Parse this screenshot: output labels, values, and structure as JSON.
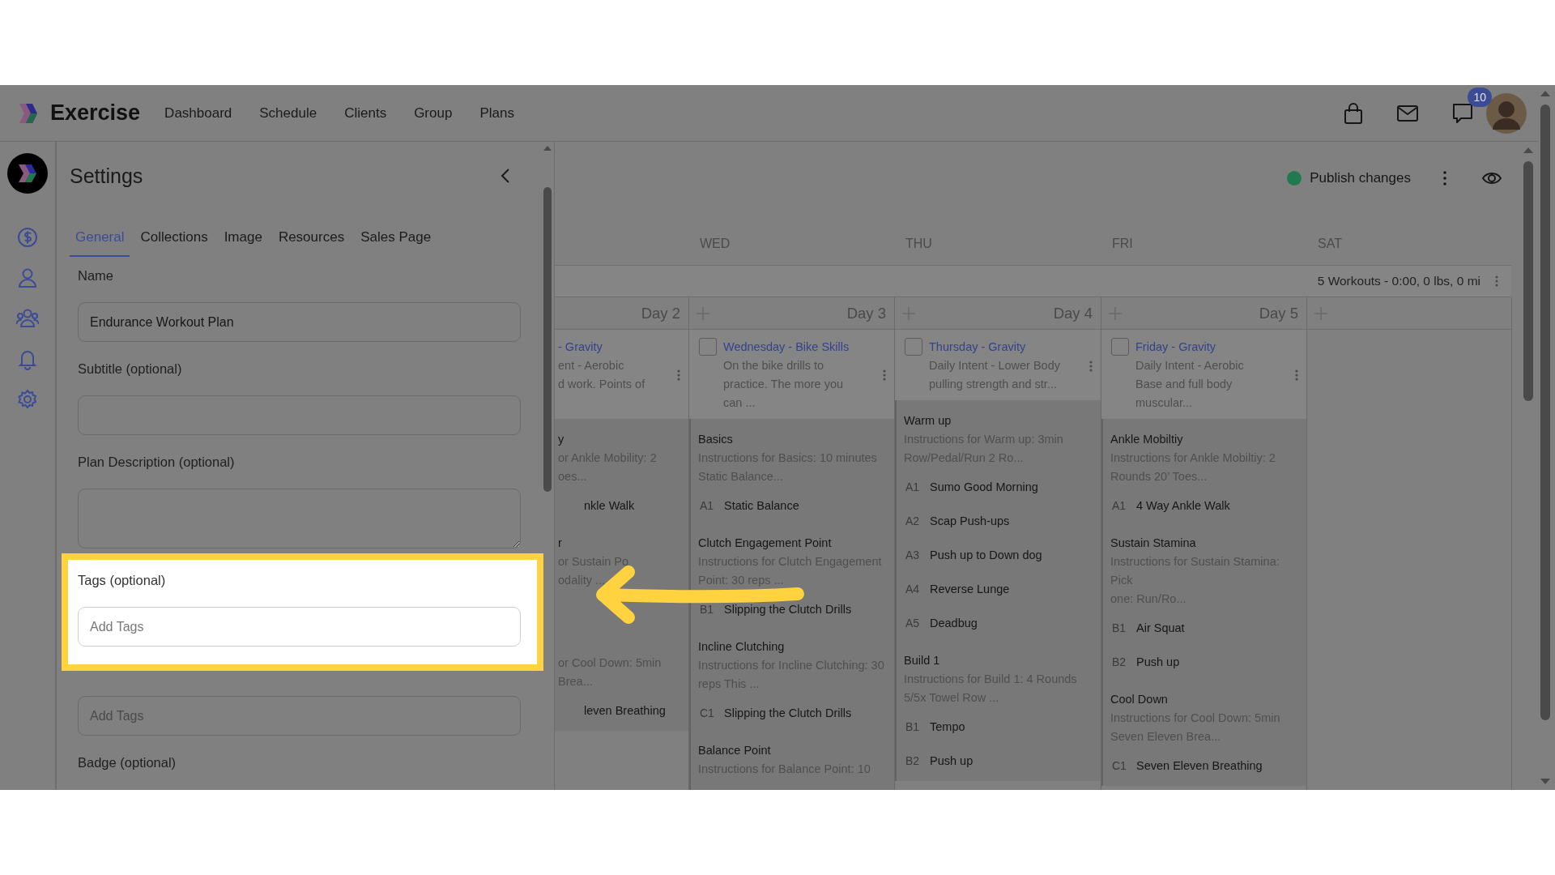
{
  "nav": {
    "brand": "Exercise",
    "links": [
      {
        "label": "Dashboard"
      },
      {
        "label": "Schedule"
      },
      {
        "label": "Clients"
      },
      {
        "label": "Group"
      },
      {
        "label": "Plans"
      }
    ],
    "chat_badge": "10"
  },
  "settings": {
    "title": "Settings",
    "tabs": [
      {
        "label": "General",
        "selected": true
      },
      {
        "label": "Collections",
        "selected": false
      },
      {
        "label": "Image",
        "selected": false
      },
      {
        "label": "Resources",
        "selected": false
      },
      {
        "label": "Sales Page",
        "selected": false
      }
    ],
    "fields": [
      {
        "kind": "input",
        "label": "Name",
        "value": "Endurance Workout Plan",
        "highlighted": false
      },
      {
        "kind": "input",
        "label": "Subtitle (optional)",
        "highlighted": false
      },
      {
        "kind": "textarea",
        "label": "Plan Description (optional)",
        "highlighted": false
      },
      {
        "kind": "input",
        "label": "Tags (optional)",
        "placeholder": "Add Tags",
        "highlighted": true
      },
      {
        "kind": "input",
        "placeholder": "Add Tags",
        "highlighted": false
      },
      {
        "kind": "label",
        "label": "Badge (optional)",
        "highlighted": false
      }
    ]
  },
  "toolbar": {
    "publish": "Publish changes"
  },
  "calendar": {
    "summary": "5 Workouts - 0:00, 0 lbs, 0 mi",
    "columns": [
      {
        "day_label": "Day 2",
        "add_button": false,
        "workout": {
          "title": "- Gravity",
          "description": "ent - Aerobic\nd work. Points of",
          "blocks": [
            {
              "name": "y",
              "instructions": "or Ankle Mobility: 2\noes...",
              "exercises": [
                {
                  "name": "nkle Walk"
                }
              ]
            },
            {
              "name": "r",
              "instructions": "or Sustain Po\nodality ..."
            },
            {
              "instructions": "or Cool Down: 5min\nBrea...",
              "exercises": [
                {
                  "name": "leven Breathing"
                }
              ]
            }
          ]
        }
      },
      {
        "weekday": "WED",
        "day_label": "Day 3",
        "add_button": true,
        "workout": {
          "checked": false,
          "title": "Wednesday - Bike Skills",
          "description": "On the bike drills to\npractice. The more you\ncan ...",
          "blocks": [
            {
              "name": "Basics",
              "instructions": "Instructions for Basics: 10 minutes\nStatic Balance...",
              "exercises": [
                {
                  "code": "A1",
                  "name": "Static Balance"
                }
              ]
            },
            {
              "name": "Clutch Engagement Point",
              "instructions": "Instructions for Clutch Engagement\nPoint: 30 reps ...",
              "exercises": [
                {
                  "code": "B1",
                  "name": "Slipping the Clutch Drills"
                }
              ]
            },
            {
              "name": "Incline Clutching",
              "instructions": "Instructions for Incline Clutching: 30\nreps This ...",
              "exercises": [
                {
                  "code": "C1",
                  "name": "Slipping the Clutch Drills"
                }
              ]
            },
            {
              "name": "Balance Point",
              "instructions": "Instructions for Balance Point: 10"
            }
          ]
        }
      },
      {
        "weekday": "THU",
        "day_label": "Day 4",
        "add_button": true,
        "workout": {
          "checked": false,
          "title": "Thursday - Gravity",
          "description": "Daily Intent - Lower Body\npulling strength and str...",
          "blocks": [
            {
              "name": "Warm up",
              "instructions": "Instructions for Warm up: 3min\nRow/Pedal/Run 2 Ro...",
              "exercises": [
                {
                  "code": "A1",
                  "name": "Sumo Good Morning"
                },
                {
                  "code": "A2",
                  "name": "Scap Push-ups"
                },
                {
                  "code": "A3",
                  "name": "Push up to Down dog"
                },
                {
                  "code": "A4",
                  "name": "Reverse Lunge"
                },
                {
                  "code": "A5",
                  "name": "Deadbug"
                }
              ]
            },
            {
              "name": "Build 1",
              "instructions": "Instructions for Build 1: 4 Rounds\n5/5x Towel Row ...",
              "exercises": [
                {
                  "code": "B1",
                  "name": "Tempo"
                },
                {
                  "code": "B2",
                  "name": "Push up"
                }
              ]
            }
          ]
        }
      },
      {
        "weekday": "FRI",
        "day_label": "Day 5",
        "add_button": true,
        "workout": {
          "checked": false,
          "title": "Friday - Gravity",
          "description": "Daily Intent - Aerobic\nBase and full body\nmuscular...",
          "blocks": [
            {
              "name": "Ankle Mobiltiy",
              "instructions": "Instructions for Ankle Mobiltiy: 2\nRounds 20’ Toes...",
              "exercises": [
                {
                  "code": "A1",
                  "name": "4 Way Ankle Walk"
                }
              ]
            },
            {
              "name": "Sustain Stamina",
              "instructions": "Instructions for Sustain Stamina: Pick\none: Run/Ro...",
              "exercises": [
                {
                  "code": "B1",
                  "name": "Air Squat"
                },
                {
                  "code": "B2",
                  "name": "Push up"
                }
              ]
            },
            {
              "name": "Cool Down",
              "instructions": "Instructions for Cool Down: 5min\nSeven Eleven Brea...",
              "exercises": [
                {
                  "code": "C1",
                  "name": "Seven Eleven Breathing"
                }
              ]
            }
          ]
        }
      },
      {
        "weekday": "SAT",
        "add_button": true
      }
    ]
  }
}
